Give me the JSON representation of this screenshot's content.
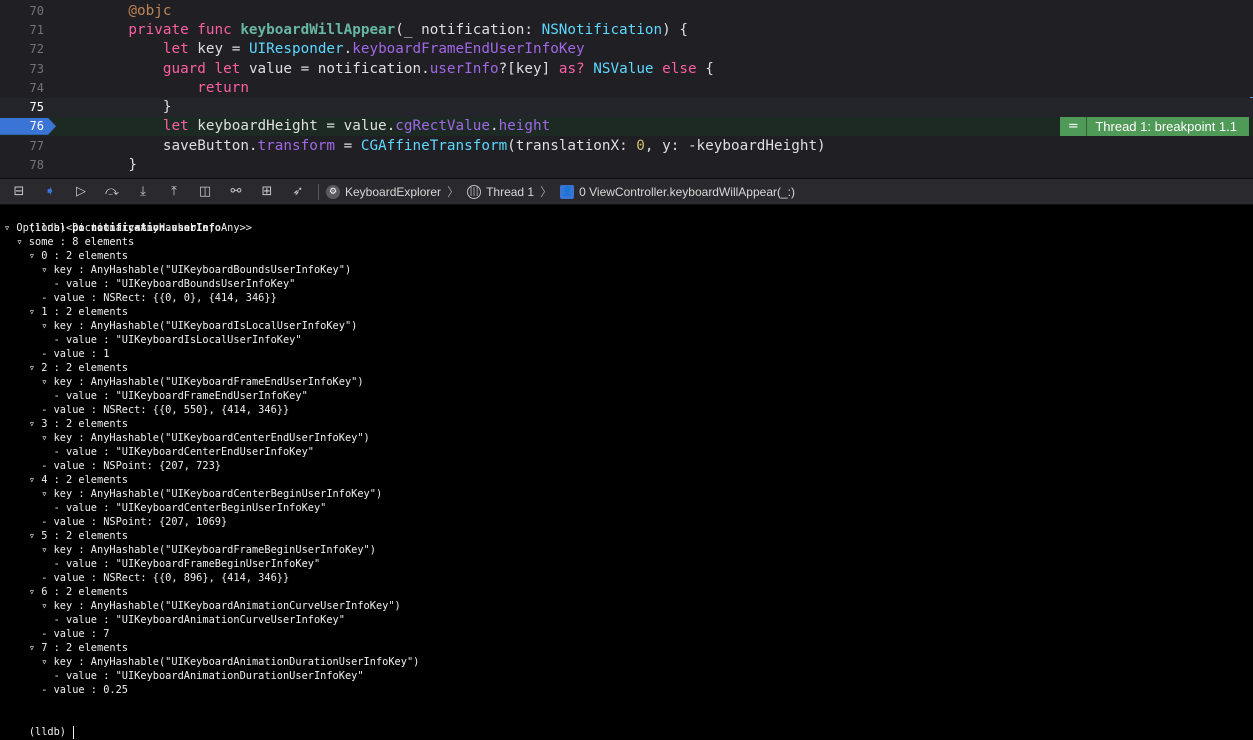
{
  "editor": {
    "lines": [
      {
        "num": "70",
        "tokens": [
          [
            "attr",
            "    @objc"
          ]
        ]
      },
      {
        "num": "71",
        "tokens": [
          [
            "kw",
            "    private func "
          ],
          [
            "fn",
            "keyboardWillAppear"
          ],
          [
            "plain",
            "(_ notification: "
          ],
          [
            "ty",
            "NSNotification"
          ],
          [
            "plain",
            ") {"
          ]
        ]
      },
      {
        "num": "72",
        "tokens": [
          [
            "kw",
            "        let "
          ],
          [
            "plain",
            "key = "
          ],
          [
            "ty",
            "UIResponder"
          ],
          [
            "plain",
            "."
          ],
          [
            "mem",
            "keyboardFrameEndUserInfoKey"
          ]
        ]
      },
      {
        "num": "73",
        "tokens": [
          [
            "kw",
            "        guard let "
          ],
          [
            "plain",
            "value = notification."
          ],
          [
            "mem",
            "userInfo"
          ],
          [
            "plain",
            "?[key] "
          ],
          [
            "kw",
            "as? "
          ],
          [
            "ty",
            "NSValue "
          ],
          [
            "kw",
            "else "
          ],
          [
            "plain",
            "{"
          ]
        ]
      },
      {
        "num": "74",
        "tokens": [
          [
            "kw",
            "            return"
          ]
        ]
      },
      {
        "num": "75",
        "tokens": [
          [
            "plain",
            "        }"
          ]
        ]
      },
      {
        "num": "76",
        "tokens": [
          [
            "kw",
            "        let "
          ],
          [
            "plain",
            "keyboardHeight = value."
          ],
          [
            "mem",
            "cgRectValue"
          ],
          [
            "plain",
            "."
          ],
          [
            "mem",
            "height"
          ]
        ]
      },
      {
        "num": "77",
        "tokens": [
          [
            "plain",
            "        saveButton."
          ],
          [
            "mem",
            "transform"
          ],
          [
            "plain",
            " = "
          ],
          [
            "ty",
            "CGAffineTransform"
          ],
          [
            "plain",
            "(translationX: "
          ],
          [
            "num",
            "0"
          ],
          [
            "plain",
            ", y: -keyboardHeight)"
          ]
        ]
      },
      {
        "num": "78",
        "tokens": [
          [
            "plain",
            "    }"
          ]
        ]
      }
    ],
    "current_line": "75",
    "breakpoint_line": "76",
    "breakpoint_eq": "=",
    "breakpoint_label": "Thread 1: breakpoint 1.1"
  },
  "debugbar": {
    "buttons": [
      {
        "name": "hide-debug-area-icon",
        "glyph": "⊟"
      },
      {
        "name": "breakpoints-toggle-icon",
        "glyph": "➧"
      },
      {
        "name": "continue-icon",
        "glyph": "▷"
      },
      {
        "name": "step-over-icon",
        "glyph": "⤼"
      },
      {
        "name": "step-into-icon",
        "glyph": "⤓"
      },
      {
        "name": "step-out-icon",
        "glyph": "⤒"
      },
      {
        "name": "view-hierarchy-icon",
        "glyph": "◫"
      },
      {
        "name": "memory-graph-icon",
        "glyph": "⚯"
      },
      {
        "name": "environment-overrides-icon",
        "glyph": "⊞"
      },
      {
        "name": "simulate-location-icon",
        "glyph": "➶"
      }
    ],
    "breadcrumbs": {
      "app": "KeyboardExplorer",
      "thread": "Thread 1",
      "frame": "0 ViewController.keyboardWillAppear(_:)"
    }
  },
  "console": {
    "prompt": "(lldb)",
    "command": "po notification.userInfo",
    "output": [
      "▿ Optional<Dictionary<AnyHashable, Any>>",
      "  ▿ some : 8 elements",
      "    ▿ 0 : 2 elements",
      "      ▿ key : AnyHashable(\"UIKeyboardBoundsUserInfoKey\")",
      "        - value : \"UIKeyboardBoundsUserInfoKey\"",
      "      - value : NSRect: {{0, 0}, {414, 346}}",
      "    ▿ 1 : 2 elements",
      "      ▿ key : AnyHashable(\"UIKeyboardIsLocalUserInfoKey\")",
      "        - value : \"UIKeyboardIsLocalUserInfoKey\"",
      "      - value : 1",
      "    ▿ 2 : 2 elements",
      "      ▿ key : AnyHashable(\"UIKeyboardFrameEndUserInfoKey\")",
      "        - value : \"UIKeyboardFrameEndUserInfoKey\"",
      "      - value : NSRect: {{0, 550}, {414, 346}}",
      "    ▿ 3 : 2 elements",
      "      ▿ key : AnyHashable(\"UIKeyboardCenterEndUserInfoKey\")",
      "        - value : \"UIKeyboardCenterEndUserInfoKey\"",
      "      - value : NSPoint: {207, 723}",
      "    ▿ 4 : 2 elements",
      "      ▿ key : AnyHashable(\"UIKeyboardCenterBeginUserInfoKey\")",
      "        - value : \"UIKeyboardCenterBeginUserInfoKey\"",
      "      - value : NSPoint: {207, 1069}",
      "    ▿ 5 : 2 elements",
      "      ▿ key : AnyHashable(\"UIKeyboardFrameBeginUserInfoKey\")",
      "        - value : \"UIKeyboardFrameBeginUserInfoKey\"",
      "      - value : NSRect: {{0, 896}, {414, 346}}",
      "    ▿ 6 : 2 elements",
      "      ▿ key : AnyHashable(\"UIKeyboardAnimationCurveUserInfoKey\")",
      "        - value : \"UIKeyboardAnimationCurveUserInfoKey\"",
      "      - value : 7",
      "    ▿ 7 : 2 elements",
      "      ▿ key : AnyHashable(\"UIKeyboardAnimationDurationUserInfoKey\")",
      "        - value : \"UIKeyboardAnimationDurationUserInfoKey\"",
      "      - value : 0.25"
    ],
    "input_prompt": "(lldb)"
  },
  "colors": {
    "breakpoint": "#3a75d6",
    "breakpoint_label_bg": "#4f9a57",
    "keyword": "#fc5fa3",
    "type": "#5dd8ff",
    "member": "#a167e6"
  }
}
